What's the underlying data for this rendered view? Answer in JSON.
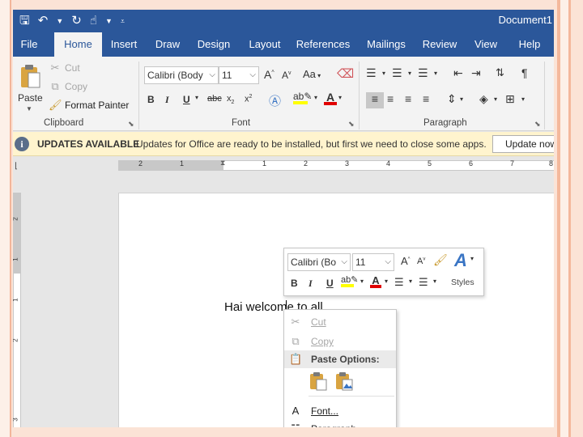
{
  "window": {
    "title": "Document1"
  },
  "tabs": [
    {
      "label": "File"
    },
    {
      "label": "Home"
    },
    {
      "label": "Insert"
    },
    {
      "label": "Draw"
    },
    {
      "label": "Design"
    },
    {
      "label": "Layout"
    },
    {
      "label": "References"
    },
    {
      "label": "Mailings"
    },
    {
      "label": "Review"
    },
    {
      "label": "View"
    },
    {
      "label": "Help"
    }
  ],
  "clipboard": {
    "paste_label": "Paste",
    "cut_label": "Cut",
    "copy_label": "Copy",
    "format_painter_label": "Format Painter",
    "group_label": "Clipboard"
  },
  "font": {
    "font_name": "Calibri (Body",
    "font_size": "11",
    "change_case_label": "Aa",
    "group_label": "Font"
  },
  "paragraph": {
    "group_label": "Paragraph"
  },
  "notification": {
    "title": "UPDATES AVAILABLE",
    "message": "Updates for Office are ready to be installed, but first we need to close some apps.",
    "button_label": "Update now"
  },
  "ruler": {
    "h_ticks": [
      "2",
      "1",
      "1",
      "2",
      "3",
      "4",
      "5",
      "6",
      "7",
      "8"
    ],
    "v_ticks": [
      "2",
      "1",
      "1",
      "2",
      "3"
    ]
  },
  "document": {
    "text": "Hai welcome to all"
  },
  "mini_toolbar": {
    "font_name": "Calibri (Bo",
    "font_size": "11",
    "styles_label": "Styles"
  },
  "context_menu": {
    "cut": "Cut",
    "copy": "Copy",
    "paste_options": "Paste Options:",
    "font": "Font...",
    "paragraph": "Paragraph..."
  },
  "colors": {
    "accent": "#2b579a",
    "highlight": "#ffff00",
    "font_color": "#e00000",
    "notification_bg": "#fff4ce"
  }
}
